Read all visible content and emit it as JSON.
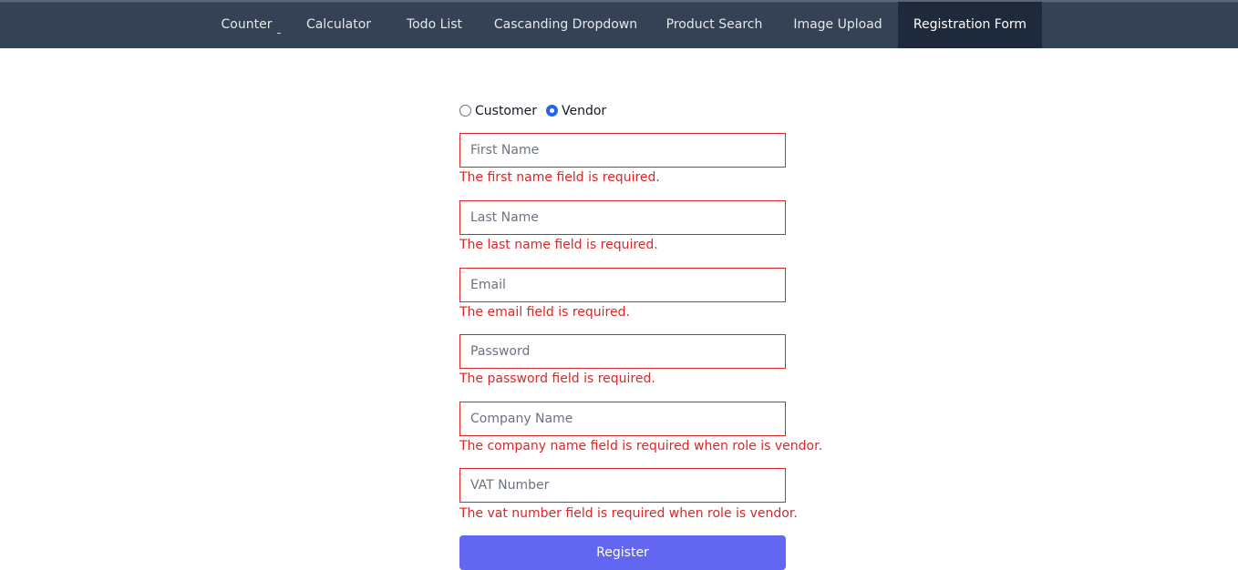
{
  "nav": {
    "items": [
      {
        "label": "Counter"
      },
      {
        "label": "Calculator"
      },
      {
        "label": "Todo List"
      },
      {
        "label": "Cascanding Dropdown"
      },
      {
        "label": "Product Search"
      },
      {
        "label": "Image Upload"
      },
      {
        "label": "Registration Form",
        "active": true
      }
    ]
  },
  "form": {
    "roles": {
      "customer_label": "Customer",
      "vendor_label": "Vendor",
      "selected": "Vendor"
    },
    "fields": {
      "first_name": {
        "placeholder": "First Name",
        "value": "",
        "error": "The first name field is required."
      },
      "last_name": {
        "placeholder": "Last Name",
        "value": "",
        "error": "The last name field is required."
      },
      "email": {
        "placeholder": "Email",
        "value": "",
        "error": "The email field is required."
      },
      "password": {
        "placeholder": "Password",
        "value": "",
        "error": "The password field is required."
      },
      "company_name": {
        "placeholder": "Company Name",
        "value": "",
        "error": "The company name field is required when role is vendor."
      },
      "vat_number": {
        "placeholder": "VAT Number",
        "value": "",
        "error": "The vat number field is required when role is vendor."
      }
    },
    "register_label": "Register"
  },
  "colors": {
    "navbar": "#334155",
    "nav_active": "#1e293b",
    "error": "#dc2626",
    "radio_checked": "#2563eb",
    "button": "#6366f1"
  }
}
